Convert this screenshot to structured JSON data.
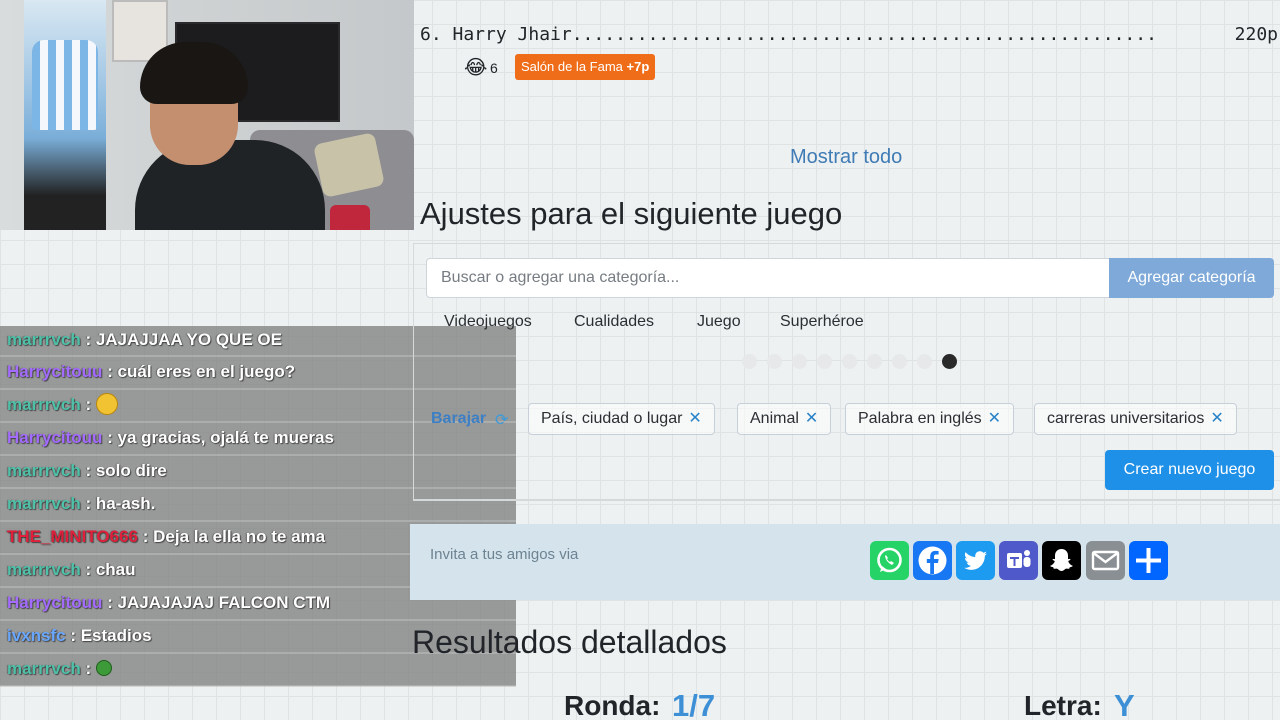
{
  "ranking": {
    "entry": "6. Harry Jhair......................................................",
    "points": "220p",
    "emoji_count": "6",
    "badge_label": "Salón de la Fama",
    "badge_bonus": "+7p"
  },
  "show_all": "Mostrar todo",
  "settings": {
    "title": "Ajustes para el siguiente juego",
    "search_placeholder": "Buscar o agregar una categoría...",
    "add_button": "Agregar categoría",
    "suggestions": [
      "Videojuegos",
      "Cualidades",
      "Juego",
      "Superhéroe"
    ],
    "shuffle": "Barajar",
    "categories": [
      "País, ciudad o lugar",
      "Animal",
      "Palabra en inglés",
      "carreras universitarios"
    ],
    "create_button": "Crear nuevo juego"
  },
  "invite": {
    "text": "Invita a tus amigos via",
    "share_icons": [
      "whatsapp-icon",
      "facebook-icon",
      "twitter-icon",
      "teams-icon",
      "snapchat-icon",
      "email-icon",
      "more-share-icon"
    ]
  },
  "results": {
    "title": "Resultados detallados",
    "round_label": "Ronda:",
    "round_value": "1/7",
    "letter_label": "Letra:",
    "letter_value": "Y"
  },
  "chat": [
    {
      "user": "marrrvch",
      "color": "#4fc1a8",
      "text": " : JAJAJJAA YO QUE OE"
    },
    {
      "user": "Harrycitouu",
      "color": "#a46bff",
      "text": " : cuál eres en el juego?"
    },
    {
      "user": "marrrvch",
      "color": "#4fc1a8",
      "text": " : ",
      "emote": "thinking-emote"
    },
    {
      "user": "Harrycitouu",
      "color": "#a46bff",
      "text": " : ya gracias, ojalá te mueras"
    },
    {
      "user": "marrrvch",
      "color": "#4fc1a8",
      "text": " : solo dire"
    },
    {
      "user": "marrrvch",
      "color": "#4fc1a8",
      "text": " : ha-ash."
    },
    {
      "user": "THE_MINITO666",
      "color": "#e0203a",
      "text": " : Deja la ella no te ama"
    },
    {
      "user": "marrrvch",
      "color": "#4fc1a8",
      "text": " : chau"
    },
    {
      "user": "Harrycitouu",
      "color": "#a46bff",
      "text": " : JAJAJAJAJ FALCON CTM"
    },
    {
      "user": "ivxnsfc",
      "color": "#6aa8ff",
      "text": " : Estadios"
    },
    {
      "user": "marrrvch",
      "color": "#4fc1a8",
      "text": " : ",
      "emote": "sick-emote"
    }
  ]
}
